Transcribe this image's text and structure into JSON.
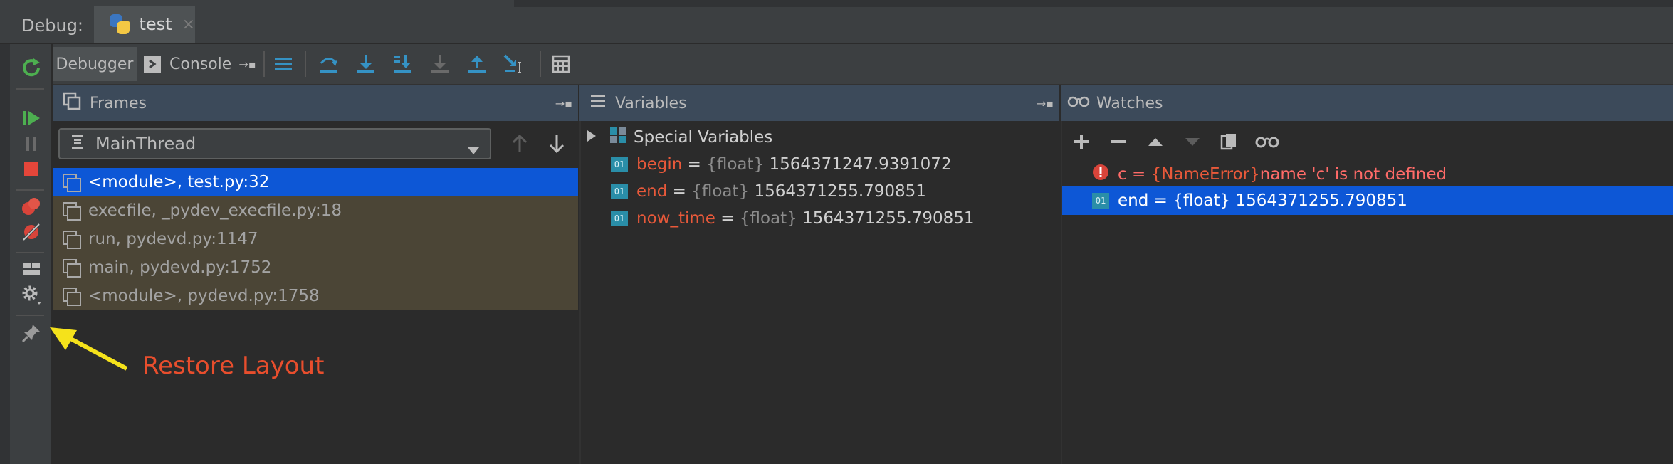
{
  "header": {
    "debug_label": "Debug:",
    "tab_name": "test",
    "tab_close": "×"
  },
  "toolbar": {
    "debugger_tab": "Debugger",
    "console_tab": "Console",
    "console_pin": "→▪"
  },
  "frames": {
    "title": "Frames",
    "pin": "→▪",
    "thread": "MainThread",
    "rows": [
      {
        "label": "<module>, test.py:32"
      },
      {
        "label": "execfile, _pydev_execfile.py:18"
      },
      {
        "label": "run, pydevd.py:1147"
      },
      {
        "label": "main, pydevd.py:1752"
      },
      {
        "label": "<module>, pydevd.py:1758"
      }
    ]
  },
  "variables": {
    "title": "Variables",
    "pin": "→▪",
    "special": "Special Variables",
    "rows": [
      {
        "name": "begin",
        "eq": " = ",
        "type": "{float}",
        "value": " 1564371247.9391072"
      },
      {
        "name": "end",
        "eq": " = ",
        "type": "{float}",
        "value": " 1564371255.790851"
      },
      {
        "name": "now_time",
        "eq": " = ",
        "type": "{float}",
        "value": " 1564371255.790851"
      }
    ]
  },
  "watches": {
    "title": "Watches",
    "error_row": {
      "name": "c",
      "eq": " = ",
      "type": "{NameError}",
      "value": "name 'c' is not defined"
    },
    "ok_row": {
      "text": "end = {float} 1564371255.790851"
    }
  },
  "annotation": {
    "text": "Restore Layout"
  },
  "colors": {
    "selection": "#0d57d6",
    "frame_lib_bg": "#4b4536",
    "error": "#ff6b68",
    "var_name": "#e9593a",
    "accent_blue": "#3592c4"
  },
  "icons": [
    "rerun-icon",
    "resume-icon",
    "pause-icon",
    "stop-icon",
    "view-breakpoints-icon",
    "mute-breakpoints-icon",
    "restore-layout-icon",
    "settings-icon",
    "pin-icon",
    "console-icon",
    "threads-icon",
    "step-over-icon",
    "step-into-icon",
    "step-into-my-code-icon",
    "force-step-into-icon",
    "step-out-icon",
    "run-to-cursor-icon",
    "evaluate-icon",
    "frames-icon",
    "variables-icon",
    "watches-icon",
    "add-icon",
    "remove-icon",
    "up-icon",
    "down-icon",
    "copy-icon",
    "glasses-icon",
    "error-icon",
    "expand-arrow-icon"
  ]
}
